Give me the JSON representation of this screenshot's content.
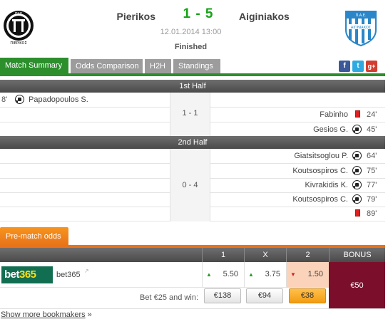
{
  "match": {
    "home_team": "Pierikos",
    "away_team": "Aiginiakos",
    "score": "1 - 5",
    "datetime": "12.01.2014 13:00",
    "status": "Finished",
    "home_logo_text": "ΠΑΕ ΠΙΕΡΙΚΟΣ",
    "away_logo_text": "Π.Α.Ε. ΑΙΓΙΝΙΑΚΟΣ"
  },
  "tabs": [
    {
      "label": "Match Summary",
      "active": true
    },
    {
      "label": "Odds Comparison",
      "active": false
    },
    {
      "label": "H2H",
      "active": false
    },
    {
      "label": "Standings",
      "active": false
    }
  ],
  "social": [
    {
      "name": "facebook",
      "glyph": "f",
      "color": "#3b5998"
    },
    {
      "name": "twitter",
      "glyph": "t",
      "color": "#2fa9e0"
    },
    {
      "name": "google-plus",
      "glyph": "g+",
      "color": "#d23f31"
    }
  ],
  "first_half": {
    "title": "1st Half",
    "score": "1 - 1",
    "events": [
      {
        "side": "home",
        "minute": "8'",
        "player": "Papadopoulos S.",
        "type": "goal"
      },
      {
        "side": "away",
        "minute": "24'",
        "player": "Fabinho",
        "type": "red-card"
      },
      {
        "side": "away",
        "minute": "45'",
        "player": "Gesios G.",
        "type": "goal"
      }
    ]
  },
  "second_half": {
    "title": "2nd Half",
    "score": "0 - 4",
    "events": [
      {
        "side": "away",
        "minute": "64'",
        "player": "Giatsitsoglou P.",
        "type": "goal"
      },
      {
        "side": "away",
        "minute": "75'",
        "player": "Koutsospiros C.",
        "type": "goal"
      },
      {
        "side": "away",
        "minute": "77'",
        "player": "Kivrakidis K.",
        "type": "goal"
      },
      {
        "side": "away",
        "minute": "79'",
        "player": "Koutsospiros C.",
        "type": "goal"
      },
      {
        "side": "away",
        "minute": "89'",
        "player": "",
        "type": "red-card"
      }
    ]
  },
  "odds": {
    "tab_label": "Pre-match odds",
    "headers": {
      "home": "1",
      "draw": "X",
      "away": "2",
      "bonus": "BONUS"
    },
    "bookmaker": {
      "logo_part1": "bet",
      "logo_part2": "365",
      "name": "bet365",
      "ext_icon": "↗",
      "home": {
        "value": "5.50",
        "trend": "up"
      },
      "draw": {
        "value": "3.75",
        "trend": "up"
      },
      "away": {
        "value": "1.50",
        "trend": "down"
      },
      "bonus": "€50"
    },
    "bet_label": "Bet €25 and win:",
    "wins": {
      "home": "€138",
      "draw": "€94",
      "away": "€38"
    },
    "more_link": "Show more bookmakers",
    "more_chevron": "»",
    "trend_colors": {
      "up": "#2c9a2c",
      "down": "#d22222"
    }
  }
}
